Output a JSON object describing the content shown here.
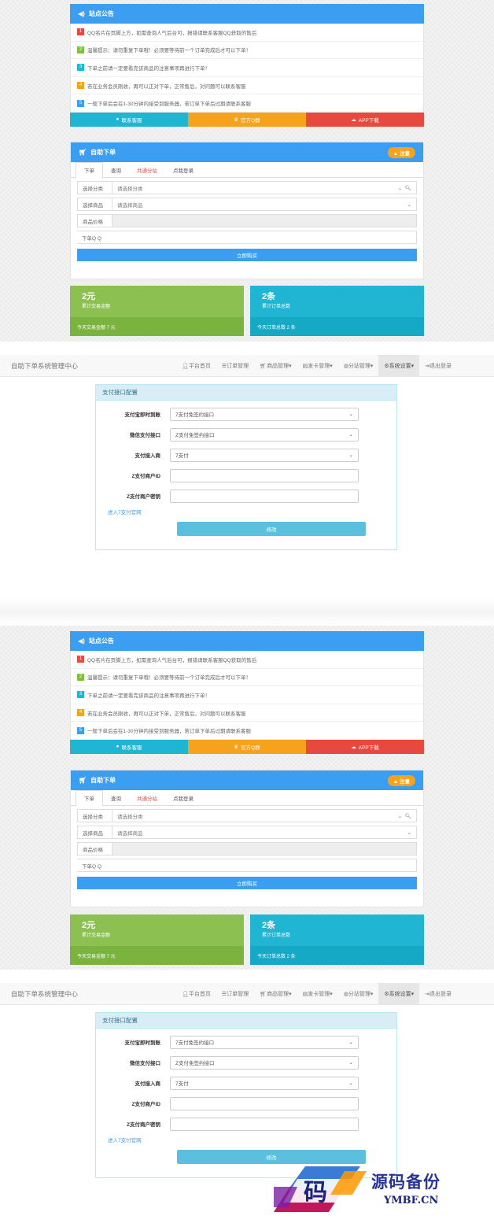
{
  "announce": {
    "title": "站点公告",
    "items": [
      {
        "n": "1",
        "color": "#e8493e",
        "text": "QQ名片在页脚上方，如需查询人气后台可，报错请联系客服QQ获取的售后"
      },
      {
        "n": "2",
        "color": "#7cc242",
        "text": "温馨提示：请勿重复下单哦！必须要等待前一个订单完成后才可以下单！"
      },
      {
        "n": "3",
        "color": "#1fb5d3",
        "text": "下单之前请一定要看完该商品的注意事项再进行下单！"
      },
      {
        "n": "4",
        "color": "#f7a21c",
        "text": "若在业务会员刚收，再可以正对下单，正常售后，对问题可以联系客服"
      },
      {
        "n": "5",
        "color": "#3c9ef0",
        "text": "一般下单后会在1-30分钟内接受到服务器，若订单下单后过期请联系客服"
      }
    ]
  },
  "buttons": {
    "contact": "联系客服",
    "group": "官方Q群",
    "app": "APP下载"
  },
  "order": {
    "title": "自助下单",
    "badge": "注意",
    "tabs": [
      "下单",
      "查询",
      "共通分站",
      "点我登录"
    ],
    "rows": [
      {
        "label": "选择分类",
        "value": "请选择分类"
      },
      {
        "label": "选择商品",
        "value": "请选择商品"
      },
      {
        "label": "商品价格",
        "value": ""
      },
      {
        "label": "下单Q Q",
        "value": ""
      }
    ],
    "buy": "立即购买"
  },
  "stats": {
    "left": {
      "big": "2元",
      "small": "累计交易金额",
      "foot": "今天交易金额 7 元",
      "bg": "#8cc152",
      "foot_bg": "#7ab43f"
    },
    "right": {
      "big": "2条",
      "small": "累计订单总数",
      "foot": "今天订单总数 2 条",
      "bg": "#1fb5d3",
      "foot_bg": "#16a9c6"
    }
  },
  "admin": {
    "brand": "自助下单系统管理中心",
    "nav": [
      "平台首页",
      "订单管理",
      "商品管理",
      "发卡管理",
      "分站管理",
      "系统设置",
      "退出登录"
    ],
    "card_title": "支付接口配置",
    "fields": [
      {
        "label": "支付宝即时到账",
        "value": "7支付免签约接口",
        "select": true
      },
      {
        "label": "微信支付接口",
        "value": "Z支付免签约接口",
        "select": true
      },
      {
        "label": "支付接入商",
        "value": "7支付",
        "select": true
      },
      {
        "label": "Z支付商户ID",
        "value": "",
        "select": false
      },
      {
        "label": "Z支付商户密钥",
        "value": "",
        "select": false
      }
    ],
    "link": "进入7支付官网",
    "ok": "修改"
  },
  "watermark": {
    "main": "源码备份",
    "sub": "YMBF.CN",
    "char": "码"
  }
}
